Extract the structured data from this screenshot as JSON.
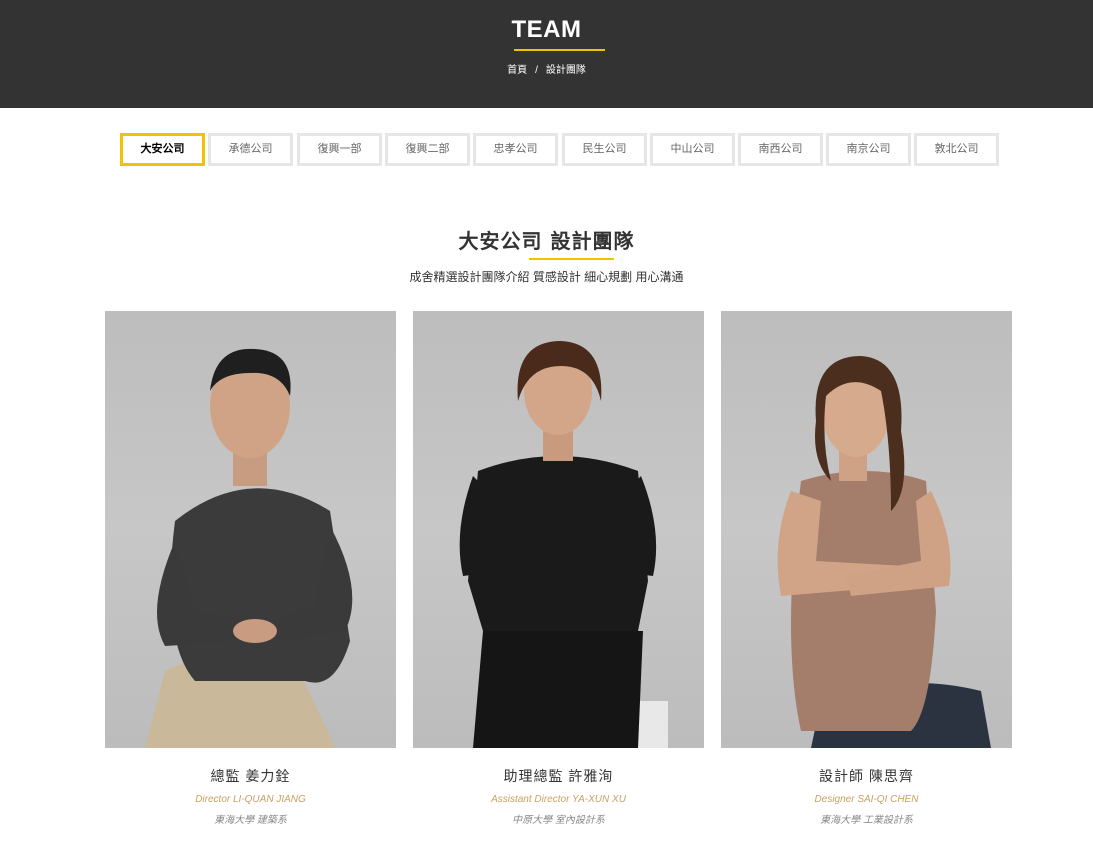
{
  "header": {
    "title": "TEAM",
    "breadcrumb": [
      "首頁",
      "/",
      "設計團隊"
    ]
  },
  "tabs": [
    {
      "label": "大安公司",
      "active": true
    },
    {
      "label": "承德公司",
      "active": false
    },
    {
      "label": "復興一部",
      "active": false
    },
    {
      "label": "復興二部",
      "active": false
    },
    {
      "label": "忠孝公司",
      "active": false
    },
    {
      "label": "民生公司",
      "active": false
    },
    {
      "label": "中山公司",
      "active": false
    },
    {
      "label": "南西公司",
      "active": false
    },
    {
      "label": "南京公司",
      "active": false
    },
    {
      "label": "敦北公司",
      "active": false
    }
  ],
  "section": {
    "title": "大安公司 設計團隊",
    "subtitle": "成舍精選設計團隊介紹 質感設計 細心規劃 用心溝通"
  },
  "members": [
    {
      "name": "總監 姜力銓",
      "title_en": "Director LI-QUAN JIANG",
      "school": "東海大學 建築系"
    },
    {
      "name": "助理總監 許雅洵",
      "title_en": "Assistant Director YA-XUN XU",
      "school": "中原大學 室內設計系"
    },
    {
      "name": "設計師 陳思齊",
      "title_en": "Designer SAI-QI CHEN",
      "school": "東海大學 工業設計系"
    }
  ],
  "colors": {
    "accent": "#f2c200",
    "header_bg": "#333333",
    "title_en": "#c8a064"
  }
}
